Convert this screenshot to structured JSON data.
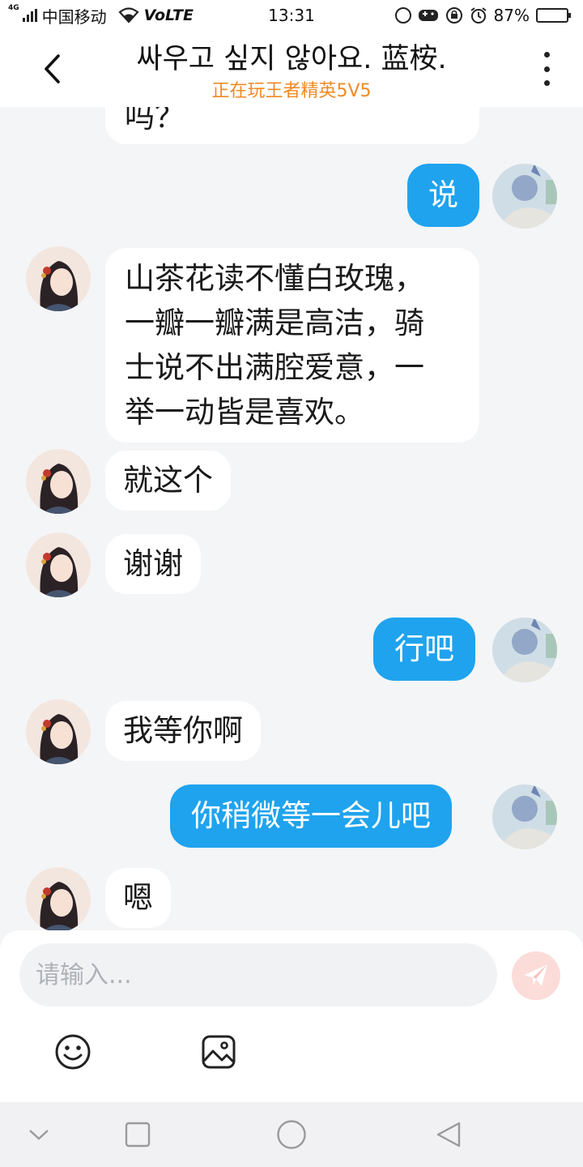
{
  "status": {
    "network_tag": "4G",
    "carrier": "中国移动",
    "volte": "VoLTE",
    "time": "13:31",
    "battery_percent": "87%",
    "battery_level": 0.87
  },
  "header": {
    "title": "싸우고 싶지 않아요. 蓝桉.",
    "subtitle": "正在玩王者精英5V5",
    "subtitle_color": "#f08a24"
  },
  "messages": [
    {
      "side": "left",
      "text": "吗？"
    },
    {
      "side": "right",
      "text": "说"
    },
    {
      "side": "left",
      "text": "山茶花读不懂白玫瑰，\n一瓣一瓣满是高洁，骑\n士说不出满腔爱意，一\n举一动皆是喜欢。"
    },
    {
      "side": "left",
      "text": "就这个"
    },
    {
      "side": "left",
      "text": "谢谢"
    },
    {
      "side": "right",
      "text": "行吧"
    },
    {
      "side": "left",
      "text": "我等你啊"
    },
    {
      "side": "right",
      "text": "你稍微等一会儿吧"
    },
    {
      "side": "left",
      "text": "嗯"
    }
  ],
  "input": {
    "placeholder": "请输入..."
  },
  "icons": {
    "back": "chevron-left-icon",
    "more": "more-vertical-icon",
    "send": "paper-plane-icon",
    "emoji": "emoji-icon",
    "image": "image-icon",
    "nav_back": "triangle-back-icon",
    "nav_home": "circle-home-icon",
    "nav_recent": "square-recent-icon",
    "nav_down": "chevron-down-icon"
  },
  "colors": {
    "bubble_right": "#1fa3ee",
    "bubble_left": "#ffffff",
    "background": "#f4f5f7",
    "send_button": "#fbdcd9"
  }
}
